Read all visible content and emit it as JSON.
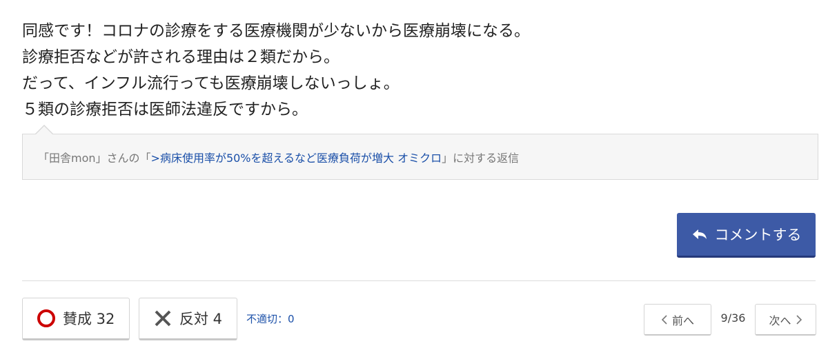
{
  "comment": {
    "lines": [
      "同感です！コロナの診療をする医療機関が少ないから医療崩壊になる。",
      "診療拒否などが許される理由は２類だから。",
      "だって、インフル流行っても医療崩壊しないっしょ。",
      "５類の診療拒否は医師法違反ですから。"
    ]
  },
  "reply": {
    "prefix": "「田舎mon」さんの「",
    "link_text": ">病床使用率が50%を超えるなど医療負荷が増大 オミクロ",
    "suffix": "」に対する返信"
  },
  "actions": {
    "comment_button_label": "コメントする",
    "comment_icon": "reply-arrow-icon"
  },
  "votes": {
    "agree_label": "賛成 32",
    "disagree_label": "反対 4",
    "agree_icon": "circle-icon",
    "disagree_icon": "cross-icon",
    "agree_color": "#cc0000",
    "disagree_color": "#555555",
    "flag_label": "不適切：0"
  },
  "pagination": {
    "prev_label": "前へ",
    "next_label": "次へ",
    "current": "9/36"
  },
  "colors": {
    "accent": "#3d5aa6",
    "link": "#1a4fa8"
  }
}
